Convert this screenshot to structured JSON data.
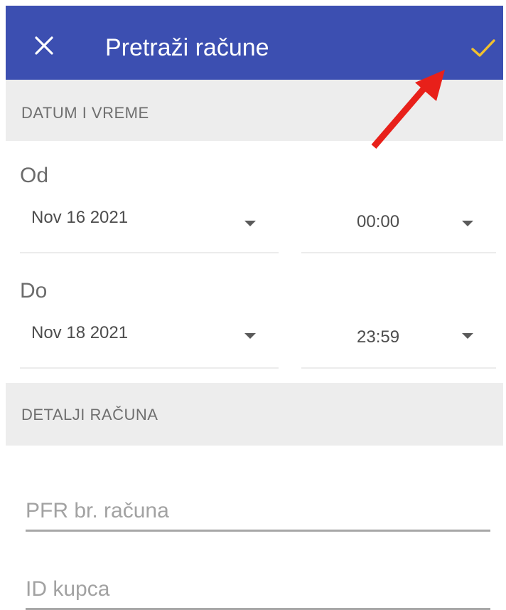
{
  "header": {
    "title": "Pretraži račune",
    "close_icon": "close-icon",
    "confirm_icon": "check-icon",
    "background_color": "#3c4fb1",
    "confirm_color": "#f2c12e"
  },
  "date_section": {
    "header": "DATUM I VREME",
    "from": {
      "label": "Od",
      "date": "Nov 16 2021",
      "time": "00:00"
    },
    "to": {
      "label": "Do",
      "date": "Nov 18 2021",
      "time": "23:59"
    }
  },
  "details_section": {
    "header": "DETALJI RAČUNA",
    "pfr_placeholder": "PFR br. računa",
    "customer_id_placeholder": "ID kupca"
  },
  "annotation": {
    "arrow_color": "#e8201a"
  }
}
